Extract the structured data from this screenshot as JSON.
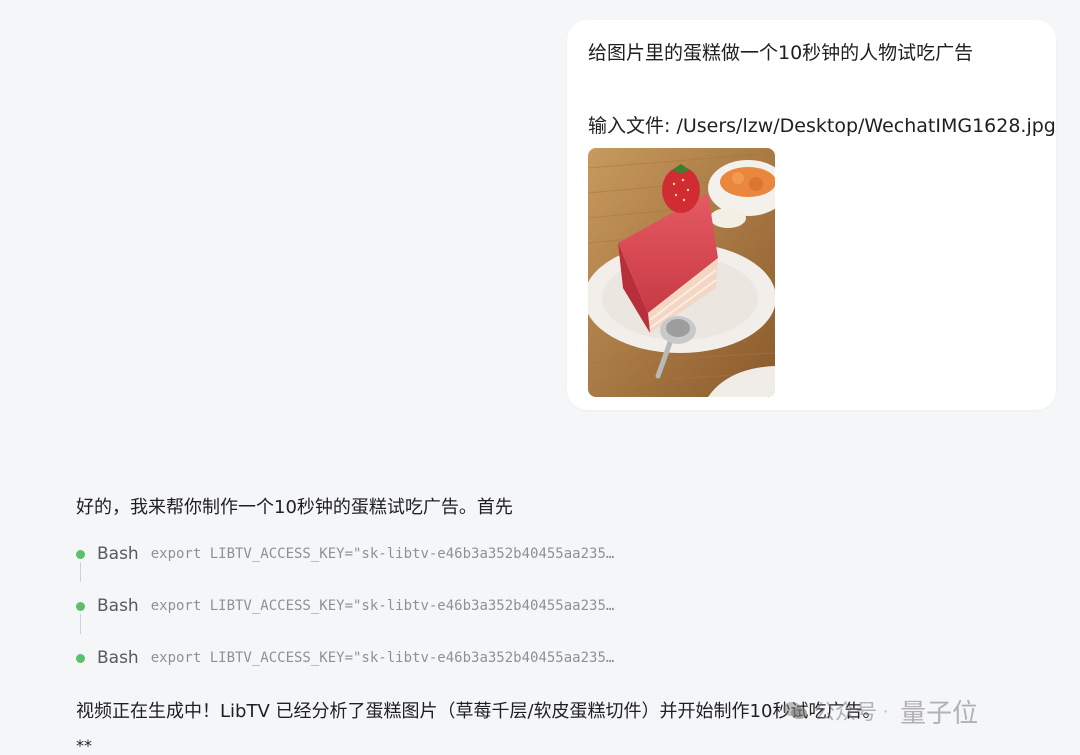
{
  "user_message": {
    "line1": "给图片里的蛋糕做一个10秒钟的人物试吃广告",
    "line2": "输入文件: /Users/lzw/Desktop/WechatIMG1628.jpg"
  },
  "assistant": {
    "intro": "好的，我来帮你制作一个10秒钟的蛋糕试吃广告。首先",
    "tools": [
      {
        "name": "Bash",
        "command": "export LIBTV_ACCESS_KEY=\"sk-libtv-e46b3a352b40455aa235…"
      },
      {
        "name": "Bash",
        "command": "export LIBTV_ACCESS_KEY=\"sk-libtv-e46b3a352b40455aa235…"
      },
      {
        "name": "Bash",
        "command": "export LIBTV_ACCESS_KEY=\"sk-libtv-e46b3a352b40455aa235…"
      }
    ],
    "status": "视频正在生成中！LibTV 已经分析了蛋糕图片（草莓千层/软皮蛋糕切件）并开始制作10秒试吃广告。",
    "trailing": "**"
  },
  "watermark": {
    "label": "公众号",
    "separator": "·",
    "brand": "量子位"
  },
  "colors": {
    "background": "#f5f6f8",
    "bubble": "#ffffff",
    "status_dot": "#5cbf6a",
    "command_text": "#8d9197"
  }
}
